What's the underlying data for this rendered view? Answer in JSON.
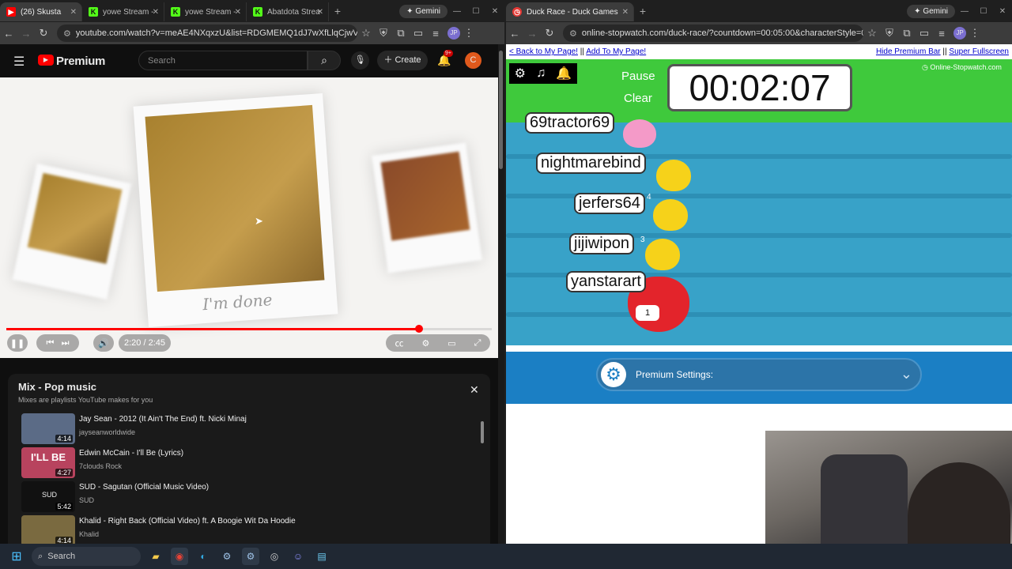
{
  "left_browser": {
    "tabs": [
      {
        "label": "(26) Skusta",
        "color": "#ff0000",
        "glyph": "▶"
      },
      {
        "label": "yowe Stream - ",
        "color": "#53fc18",
        "glyph": "K"
      },
      {
        "label": "yowe Stream - ",
        "color": "#53fc18",
        "glyph": "K"
      },
      {
        "label": "Abatdota Strea",
        "color": "#53fc18",
        "glyph": "K"
      }
    ],
    "gemini": "Gemini",
    "url": "youtube.com/watch?v=meAE4NXqxzU&list=RDGMEMQ1dJ7wXfLlqCjwV...",
    "profile": "JP"
  },
  "youtube": {
    "logo": "Premium",
    "search_placeholder": "Search",
    "create_label": "Create",
    "notif_badge": "9+",
    "avatar_letter": "C",
    "video_caption": "I'm done",
    "time": "2:20 / 2:45",
    "progress": 0.85,
    "playlist_title": "Mix - Pop music",
    "playlist_sub": "Mixes are playlists YouTube makes for you",
    "items": [
      {
        "title": "Jay Sean - 2012 (It Ain't The End) ft. Nicki Minaj",
        "channel": "jayseanworldwide",
        "duration": "4:14",
        "thumb": "#5b6b86"
      },
      {
        "title": "Edwin McCain - I'll Be (Lyrics)",
        "channel": "7clouds Rock",
        "duration": "4:27",
        "thumb": "#b8435e",
        "thumb_text": "I'LL BE"
      },
      {
        "title": "SUD - Sagutan (Official Music Video)",
        "channel": "SUD",
        "duration": "5:42",
        "thumb": "#111111",
        "thumb_text": "SUD"
      },
      {
        "title": "Khalid - Right Back (Official Video) ft. A Boogie Wit Da Hoodie",
        "channel": "Khalid",
        "duration": "4:14",
        "thumb": "#7a6a40"
      }
    ]
  },
  "right_browser": {
    "tab": "Duck Race - Duck Games",
    "gemini": "Gemini",
    "url": "online-stopwatch.com/duck-race/?countdown=00:05:00&characterStyle=0&...",
    "profile": "JP"
  },
  "duck_race": {
    "back_link": "< Back to My Page!",
    "sep1": "||",
    "add_link": "Add To My Page!",
    "hide_link": "Hide Premium Bar",
    "sep2": "||",
    "fullscreen_link": "Super Fullscreen",
    "pause": "Pause",
    "clear": "Clear",
    "timer": "00:02:07",
    "brand": "Online-Stopwatch.com",
    "racers": [
      {
        "name": "69tractor69",
        "color": "#f49ac8"
      },
      {
        "name": "nightmarebind",
        "color": "#f6d21a"
      },
      {
        "name": "jerfers64",
        "color": "#f6d21a",
        "num": "4"
      },
      {
        "name": "jijiwipon",
        "color": "#f6d21a",
        "num": "3"
      },
      {
        "name": "yanstarart",
        "color": "#e3242b",
        "num": "1"
      }
    ],
    "settings_label": "Premium Settings:"
  },
  "taskbar": {
    "search": "Search"
  }
}
